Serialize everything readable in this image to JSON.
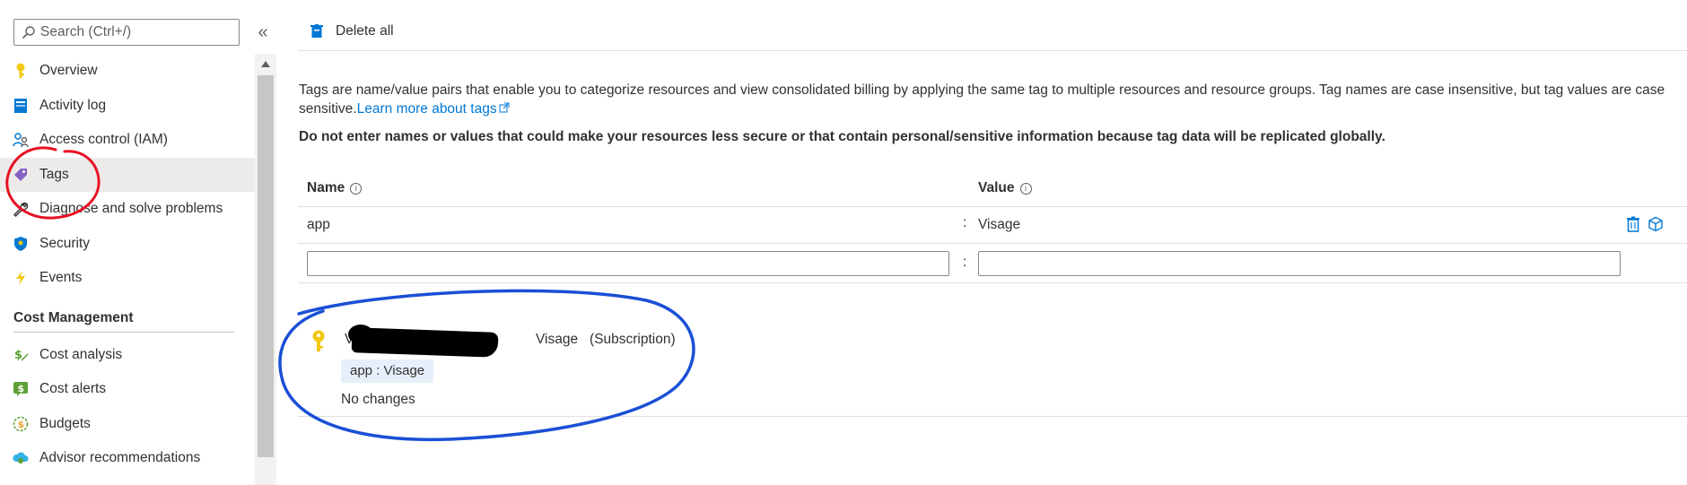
{
  "sidebar": {
    "search_placeholder": "Search (Ctrl+/)",
    "collapse_glyph": "«",
    "items": [
      {
        "label": "Overview",
        "icon": "key-icon"
      },
      {
        "label": "Activity log",
        "icon": "activity-log-icon"
      },
      {
        "label": "Access control (IAM)",
        "icon": "people-icon"
      },
      {
        "label": "Tags",
        "icon": "tag-icon",
        "selected": true
      },
      {
        "label": "Diagnose and solve problems",
        "icon": "wrench-icon"
      },
      {
        "label": "Security",
        "icon": "shield-icon"
      },
      {
        "label": "Events",
        "icon": "lightning-icon"
      }
    ],
    "section_title": "Cost Management",
    "cost_items": [
      {
        "label": "Cost analysis",
        "icon": "cost-analysis-icon"
      },
      {
        "label": "Cost alerts",
        "icon": "cost-alerts-icon"
      },
      {
        "label": "Budgets",
        "icon": "budgets-icon"
      },
      {
        "label": "Advisor recommendations",
        "icon": "advisor-icon"
      }
    ]
  },
  "toolbar": {
    "delete_all_label": "Delete all"
  },
  "description": {
    "text": "Tags are name/value pairs that enable you to categorize resources and view consolidated billing by applying the same tag to multiple resources and resource groups. Tag names are case insensitive, but tag values are case sensitive.",
    "link_text": "Learn more about tags",
    "warning": "Do not enter names or values that could make your resources less secure or that contain personal/sensitive information because tag data will be replicated globally."
  },
  "table": {
    "name_header": "Name",
    "value_header": "Value",
    "separator": ":",
    "rows": [
      {
        "name": "app",
        "value": "Visage"
      }
    ],
    "new_row": {
      "name": "",
      "value": ""
    }
  },
  "resource": {
    "title_start": "V",
    "title_end": "Visage   (Subscription)",
    "tag_chip": "app : Visage",
    "status": "No changes"
  },
  "colors": {
    "accent": "#0078d4",
    "selected_bg": "#edebe9",
    "annotation_red": "#e81123",
    "annotation_blue": "#1a4fd6"
  }
}
